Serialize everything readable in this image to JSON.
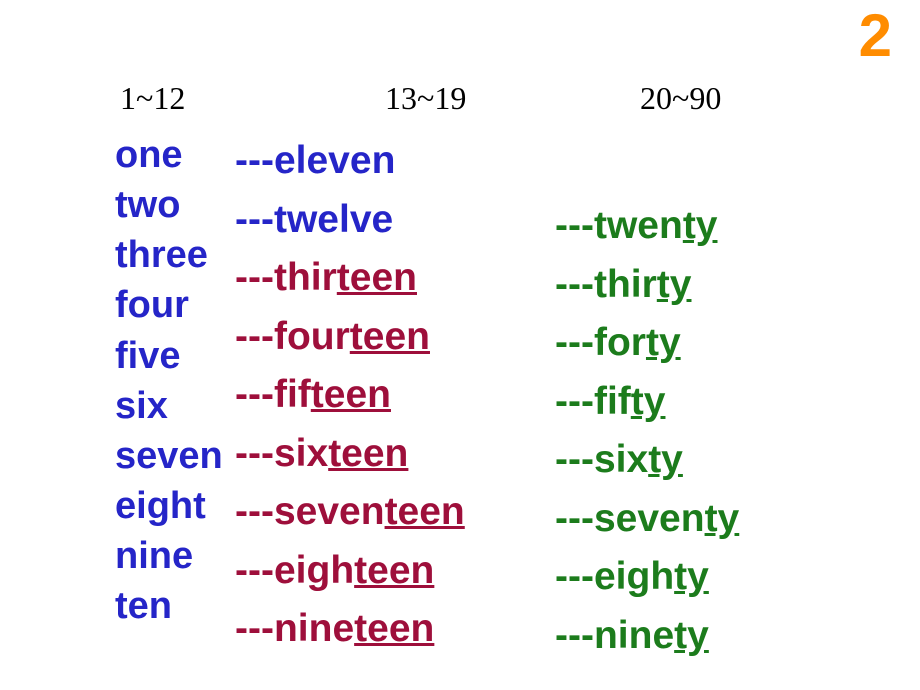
{
  "page_number": "2",
  "headers": {
    "col1": "1~12",
    "col2": "13~19",
    "col3": "20~90"
  },
  "col1": [
    "one",
    "two",
    "three",
    "four",
    "five",
    "six",
    "seven",
    "eight",
    "nine",
    "ten"
  ],
  "col2": [
    {
      "prefix": "---",
      "base": "eleven",
      "suffix": "",
      "style": "blue"
    },
    {
      "prefix": "---",
      "base": "twelve",
      "suffix": "",
      "style": "blue"
    },
    {
      "prefix": "---",
      "base": "thir",
      "suffix": "teen",
      "style": "maroon"
    },
    {
      "prefix": "---",
      "base": "four",
      "suffix": "teen",
      "style": "maroon"
    },
    {
      "prefix": "---",
      "base": "fif",
      "suffix": "teen",
      "style": "maroon"
    },
    {
      "prefix": "---",
      "base": "six",
      "suffix": "teen",
      "style": "maroon"
    },
    {
      "prefix": "---",
      "base": "seven",
      "suffix": "teen",
      "style": "maroon"
    },
    {
      "prefix": "---",
      "base": "eigh",
      "suffix": "teen",
      "style": "maroon"
    },
    {
      "prefix": "---",
      "base": "nine",
      "suffix": "teen",
      "style": "maroon"
    }
  ],
  "col3": [
    {
      "prefix": "---",
      "base": "twen",
      "suffix": "ty"
    },
    {
      "prefix": "---",
      "base": "thir",
      "suffix": "ty"
    },
    {
      "prefix": "---",
      "base": "for",
      "suffix": "ty"
    },
    {
      "prefix": "---",
      "base": "fif",
      "suffix": "ty"
    },
    {
      "prefix": "---",
      "base": "six",
      "suffix": "ty"
    },
    {
      "prefix": "---",
      "base": "seven",
      "suffix": "ty"
    },
    {
      "prefix": "---",
      "base": "eigh",
      "suffix": "ty"
    },
    {
      "prefix": "---",
      "base": "nine",
      "suffix": "ty"
    }
  ]
}
